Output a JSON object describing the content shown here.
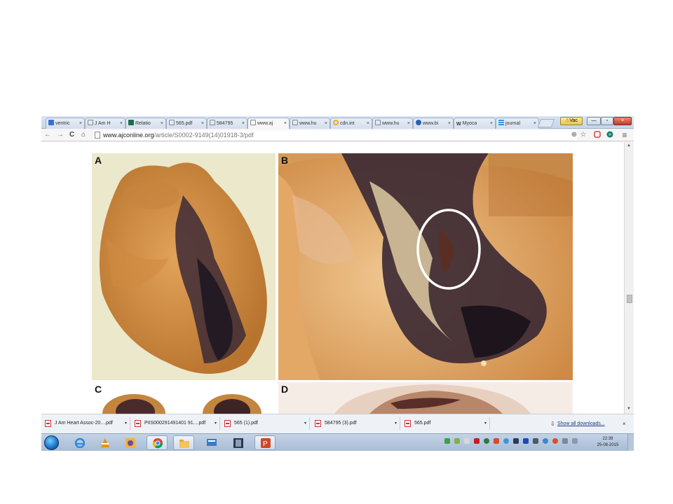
{
  "tabs": [
    {
      "label": "ventric",
      "icon_color": "#3b6fd8",
      "icon": "google-scholar-icon"
    },
    {
      "label": "J Am H",
      "icon_color": "#ffffff",
      "icon": "page-icon"
    },
    {
      "label": "Relatio",
      "icon_color": "#1f6b4f",
      "icon": "ka-icon"
    },
    {
      "label": "565.pdf",
      "icon_color": "#ffffff",
      "icon": "page-icon"
    },
    {
      "label": "584795",
      "icon_color": "#ffffff",
      "icon": "page-icon"
    },
    {
      "label": "www.aj",
      "icon_color": "#ffffff",
      "icon": "page-icon"
    },
    {
      "label": "www.hu",
      "icon_color": "#ffffff",
      "icon": "page-icon"
    },
    {
      "label": "cdn.int",
      "icon_color": "#f3a81d",
      "icon": "ring-icon"
    },
    {
      "label": "www.hu",
      "icon_color": "#ffffff",
      "icon": "page-icon"
    },
    {
      "label": "www.bi",
      "icon_color": "#2b5fb5",
      "icon": "globe-icon"
    },
    {
      "label": "Myoca",
      "icon_color": "#ffffff",
      "icon": "wikipedia-icon"
    },
    {
      "label": "journal",
      "icon_color": "#3a8ad8",
      "icon": "journal-icon"
    }
  ],
  "tab_close": "×",
  "window_user": "Vac",
  "url": {
    "host": "www.ajconline.org",
    "path": "/article/S0002-9149(14)01918-3/pdf"
  },
  "nav": {
    "back": "←",
    "forward": "→",
    "reload": "C",
    "home": "⌂",
    "zoom": "⊕",
    "star": "☆",
    "menu": "≡"
  },
  "figure_panels": [
    {
      "label": "A"
    },
    {
      "label": "B"
    },
    {
      "label": "C"
    },
    {
      "label": "D"
    }
  ],
  "downloads": [
    {
      "name": "J Am Heart Assoc-20....pdf"
    },
    {
      "name": "PIIS000291491401 91....pdf"
    },
    {
      "name": "565 (1).pdf"
    },
    {
      "name": "584795 (3).pdf"
    },
    {
      "name": "565.pdf"
    }
  ],
  "show_all": "Show all downloads...",
  "download_caret": "▾",
  "close_glyph": "×",
  "clock": {
    "time": "22:39",
    "date": "25-08-2015"
  },
  "colors": {
    "accent": "#3b6fd8",
    "pdf_red": "#cc3333",
    "taskbar": "#b3c4da"
  }
}
